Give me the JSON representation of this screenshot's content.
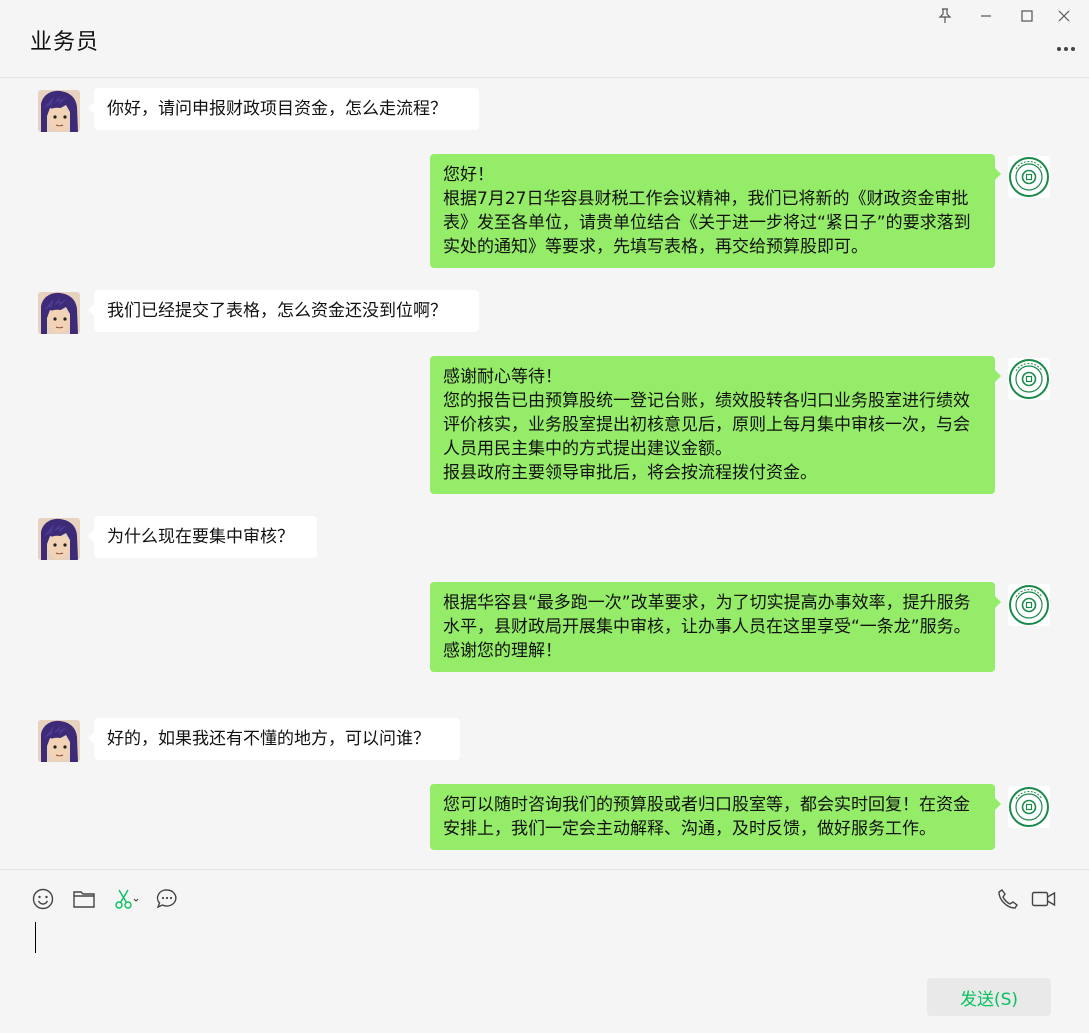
{
  "window": {
    "title": "业务员"
  },
  "messages": [
    {
      "from": "user",
      "text": "你好，请问申报财政项目资金，怎么走流程？"
    },
    {
      "from": "agent",
      "text": "您好！\n根据7月27日华容县财税工作会议精神，我们已将新的《财政资金审批表》发至各单位，请贵单位结合《关于进一步将过“紧日子”的要求落到实处的通知》等要求，先填写表格，再交给预算股即可。"
    },
    {
      "from": "user",
      "text": "我们已经提交了表格，怎么资金还没到位啊？"
    },
    {
      "from": "agent",
      "text": "感谢耐心等待！\n您的报告已由预算股统一登记台账，绩效股转各归口业务股室进行绩效评价核实，业务股室提出初核意见后，原则上每月集中审核一次，与会人员用民主集中的方式提出建议金额。\n报县政府主要领导审批后，将会按流程拨付资金。"
    },
    {
      "from": "user",
      "text": "为什么现在要集中审核？"
    },
    {
      "from": "agent",
      "text": "根据华容县“最多跑一次”改革要求，为了切实提高办事效率，提升服务水平，县财政局开展集中审核，让办事人员在这里享受“一条龙”服务。\n感谢您的理解！"
    },
    {
      "from": "user",
      "text": "好的，如果我还有不懂的地方，可以问谁？"
    },
    {
      "from": "agent",
      "text": "您可以随时咨询我们的预算股或者归口股室等，都会实时回复！在资金安排上，我们一定会主动解释、沟通，及时反馈，做好服务工作。"
    }
  ],
  "input": {
    "value": "",
    "send_label": "发送(S)"
  },
  "icons": {
    "pin": "pin-icon",
    "minimize": "minimize-icon",
    "maximize": "maximize-icon",
    "close": "close-icon",
    "more": "more-icon",
    "emoji": "emoji-icon",
    "folder": "folder-icon",
    "screenshot": "scissors-icon",
    "chat_history": "chat-bubble-icon",
    "voice_call": "phone-icon",
    "video_call": "video-icon"
  },
  "colors": {
    "outgoing_bubble": "#95ec69",
    "incoming_bubble": "#ffffff",
    "background": "#f5f5f5",
    "send_text": "#07c160",
    "seal_green": "#1a8a4a"
  }
}
